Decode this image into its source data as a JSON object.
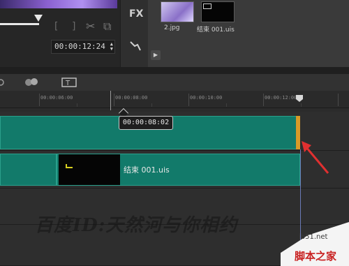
{
  "preview": {
    "mark_in": "[",
    "mark_out": "]",
    "timecode": "00:00:12:24"
  },
  "sidebar": {
    "fx_label": "FX"
  },
  "library": {
    "items": [
      {
        "label": "2.jpg"
      },
      {
        "label": "结束 001.uis"
      }
    ]
  },
  "ruler": {
    "labels": [
      "00:00:06:00",
      "00:00:08:00",
      "00:00:10:00",
      "00:00:12:00"
    ]
  },
  "timeline": {
    "tooltip_time": "00:00:08:02",
    "clip2_label": "结束 001.uis"
  },
  "watermark": "百度ID:天然河与你相约",
  "site": {
    "domain": "jb51.net",
    "name": "脚本之家"
  },
  "colors": {
    "clip_fill": "#127a6a",
    "trim_handle": "#d89a28",
    "arrow": "#e03030"
  }
}
